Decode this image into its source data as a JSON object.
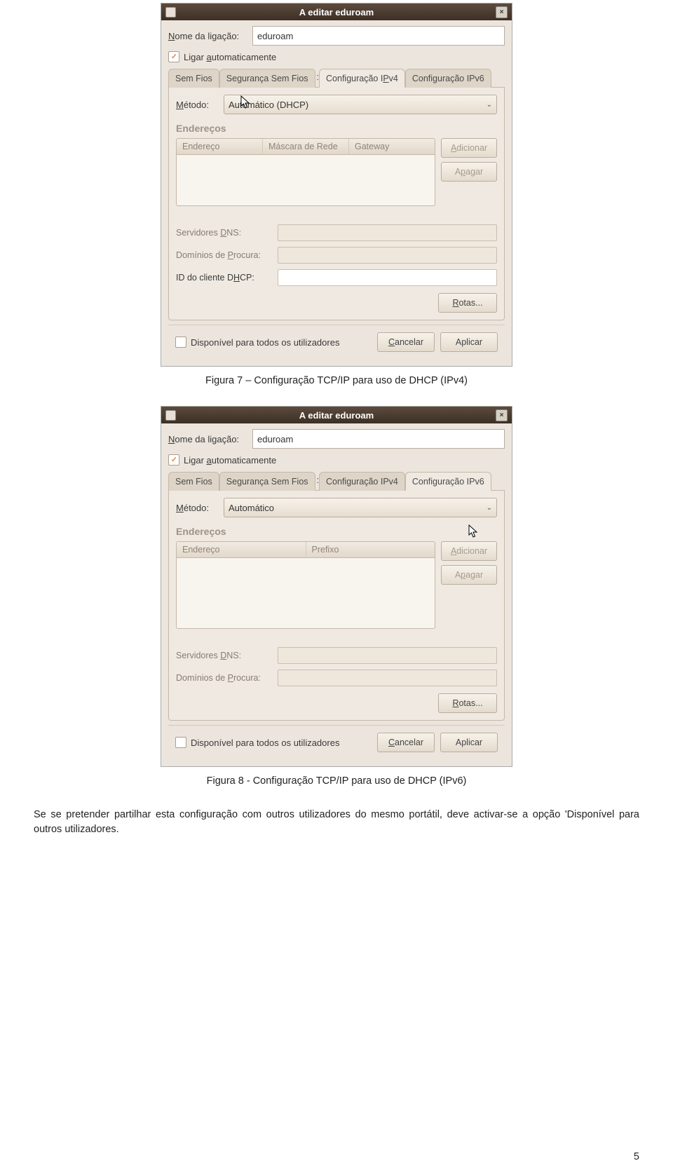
{
  "captions": {
    "fig7": "Figura 7 – Configuração TCP/IP para uso de DHCP (IPv4)",
    "fig8": "Figura 8 - Configuração TCP/IP para uso de DHCP (IPv6)"
  },
  "bodytext": "Se se pretender partilhar esta configuração com outros utilizadores do mesmo portátil, deve activar-se a opção 'Disponível para outros utilizadores.",
  "pagenum": "5",
  "dialog1": {
    "title": "A editar eduroam",
    "close_x": "×",
    "name_label_pre": "N",
    "name_label_post": "ome da ligação:",
    "name_value": "eduroam",
    "auto_label_pre": "Ligar ",
    "auto_label_u": "a",
    "auto_label_post": "utomaticamente",
    "tabs": [
      "Sem Fios",
      "Segurança Sem Fios"
    ],
    "tabs_suffix": ":",
    "tab_active_pre": "Configuração I",
    "tab_active_u": "P",
    "tab_active_post": "v4",
    "tab_right": "Configuração IPv6",
    "method_label_u": "M",
    "method_label_post": "étodo:",
    "method_value": "Automático (DHCP)",
    "addresses_head": "Endereços",
    "cols": [
      "Endereço",
      "Máscara de Rede",
      "Gateway"
    ],
    "add_btn_u": "A",
    "add_btn_post": "dicionar",
    "del_btn_pre": "A",
    "del_btn_u": "p",
    "del_btn_post": "agar",
    "dns_label_pre": "Servidores ",
    "dns_label_u": "D",
    "dns_label_post": "NS:",
    "search_label_pre": "Domínios de ",
    "search_label_u": "P",
    "search_label_post": "rocura:",
    "dhcp_label_pre": "ID do cliente D",
    "dhcp_label_u": "H",
    "dhcp_label_post": "CP:",
    "routes_u": "R",
    "routes_post": "otas...",
    "avail_label": "Disponível para todos os utilizadores",
    "cancel_u": "C",
    "cancel_post": "ancelar",
    "apply": "Aplicar"
  },
  "dialog2": {
    "title": "A editar eduroam",
    "close_x": "×",
    "name_label_pre": "N",
    "name_label_post": "ome da ligação:",
    "name_value": "eduroam",
    "auto_label_pre": "Ligar ",
    "auto_label_u": "a",
    "auto_label_post": "utomaticamente",
    "tabs": [
      "Sem Fios",
      "Segurança Sem Fios",
      "Configuração IPv4"
    ],
    "tabs_suffix": ":",
    "tab_active": "Configuração IPv6",
    "method_label_u": "M",
    "method_label_post": "étodo:",
    "method_value": "Automático",
    "addresses_head": "Endereços",
    "cols": [
      "Endereço",
      "Prefixo"
    ],
    "add_btn_u": "A",
    "add_btn_post": "dicionar",
    "del_btn_pre": "A",
    "del_btn_u": "p",
    "del_btn_post": "agar",
    "dns_label_pre": "Servidores ",
    "dns_label_u": "D",
    "dns_label_post": "NS:",
    "search_label_pre": "Domínios de ",
    "search_label_u": "P",
    "search_label_post": "rocura:",
    "routes_u": "R",
    "routes_post": "otas...",
    "avail_label": "Disponível para todos os utilizadores",
    "cancel_u": "C",
    "cancel_post": "ancelar",
    "apply": "Aplicar"
  }
}
